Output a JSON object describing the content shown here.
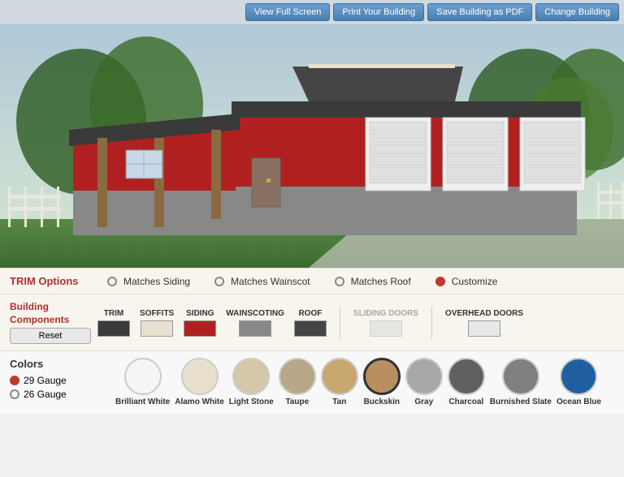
{
  "toolbar": {
    "view_full_screen": "View Full Screen",
    "print_building": "Print Your Building",
    "save_pdf": "Save Building as PDF",
    "change_building": "Change Building"
  },
  "trim_options": {
    "label": "TRIM Options",
    "options": [
      {
        "label": "Matches Siding",
        "selected": false
      },
      {
        "label": "Matches Wainscot",
        "selected": false
      },
      {
        "label": "Matches Roof",
        "selected": false
      },
      {
        "label": "Customize",
        "selected": true
      }
    ]
  },
  "building_components": {
    "label": "Building Components",
    "reset_label": "Reset",
    "components": [
      {
        "id": "trim",
        "label": "TRIM",
        "color": "#3a3a3a"
      },
      {
        "id": "soffits",
        "label": "SOFFITS",
        "color": "#e8e0d0"
      },
      {
        "id": "siding",
        "label": "SIDING",
        "color": "#b02020"
      },
      {
        "id": "wainscoting",
        "label": "WAINSCOTING",
        "color": "#888888"
      },
      {
        "id": "roof",
        "label": "ROOF",
        "color": "#454545"
      }
    ],
    "sliding_doors": {
      "label": "SLIDING DOORS",
      "color": "#d0d0d0",
      "disabled": true
    },
    "overhead_doors": {
      "label": "OVERHEAD DOORS",
      "color": "#e8e8e8"
    }
  },
  "colors": {
    "title": "Colors",
    "gauge_options": [
      {
        "label": "29 Gauge",
        "selected": true
      },
      {
        "label": "26 Gauge",
        "selected": false
      }
    ],
    "swatches": [
      {
        "label": "Brilliant White",
        "color": "#f5f5f5",
        "selected": false
      },
      {
        "label": "Alamo White",
        "color": "#e8e0cc",
        "selected": false
      },
      {
        "label": "Light Stone",
        "color": "#d4c8a8",
        "selected": false
      },
      {
        "label": "Taupe",
        "color": "#b8a888",
        "selected": false
      },
      {
        "label": "Tan",
        "color": "#c8a870",
        "selected": false
      },
      {
        "label": "Buckskin",
        "color": "#b89060",
        "selected": true
      },
      {
        "label": "Gray",
        "color": "#a8a8a8",
        "selected": false
      },
      {
        "label": "Charcoal",
        "color": "#606060",
        "selected": false
      },
      {
        "label": "Burnished Slate",
        "color": "#808080",
        "selected": false
      },
      {
        "label": "Ocean Blue",
        "color": "#2060a0",
        "selected": false
      }
    ]
  }
}
